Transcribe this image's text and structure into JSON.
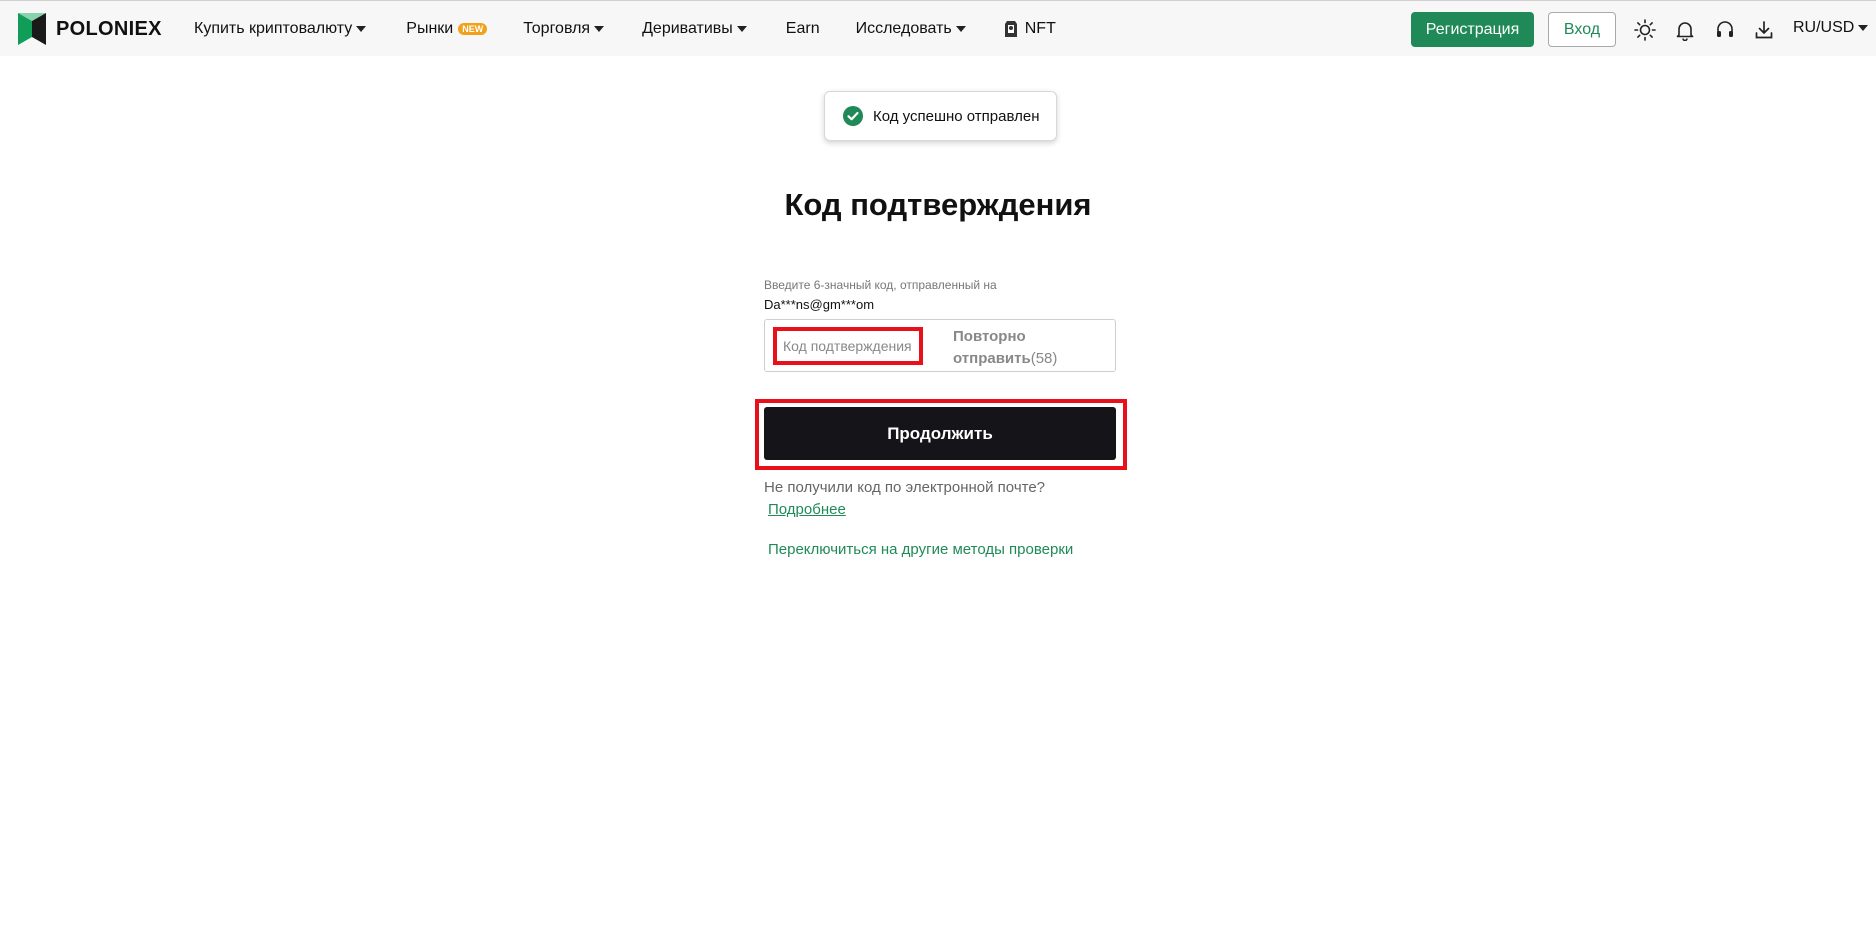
{
  "header": {
    "brand": "POLONIEX",
    "nav": [
      {
        "label": "Купить криптовалюту",
        "caret": true
      },
      {
        "label": "Рынки",
        "badge": "NEW"
      },
      {
        "label": "Торговля",
        "caret": true
      },
      {
        "label": "Деривативы",
        "caret": true
      },
      {
        "label": "Earn"
      },
      {
        "label": "Исследовать",
        "caret": true
      },
      {
        "label": "NFT"
      }
    ],
    "register_label": "Регистрация",
    "login_label": "Вход",
    "language": "RU/USD",
    "accent_color": "#1f8a58"
  },
  "toast": {
    "message": "Код успешно отправлен"
  },
  "verify": {
    "title": "Код подтверждения",
    "hint": "Введите 6-значный код, отправленный на",
    "email": "Da***ns@gm***om",
    "code_placeholder": "Код подтверждения",
    "resend_line1": "Повторно",
    "resend_line2": "отправить",
    "resend_count": "(58)",
    "continue_label": "Продолжить",
    "no_code_text": "Не получили код по электронной почте?",
    "more_link": "Подробнее",
    "switch_link": "Переключиться на другие методы проверки"
  }
}
